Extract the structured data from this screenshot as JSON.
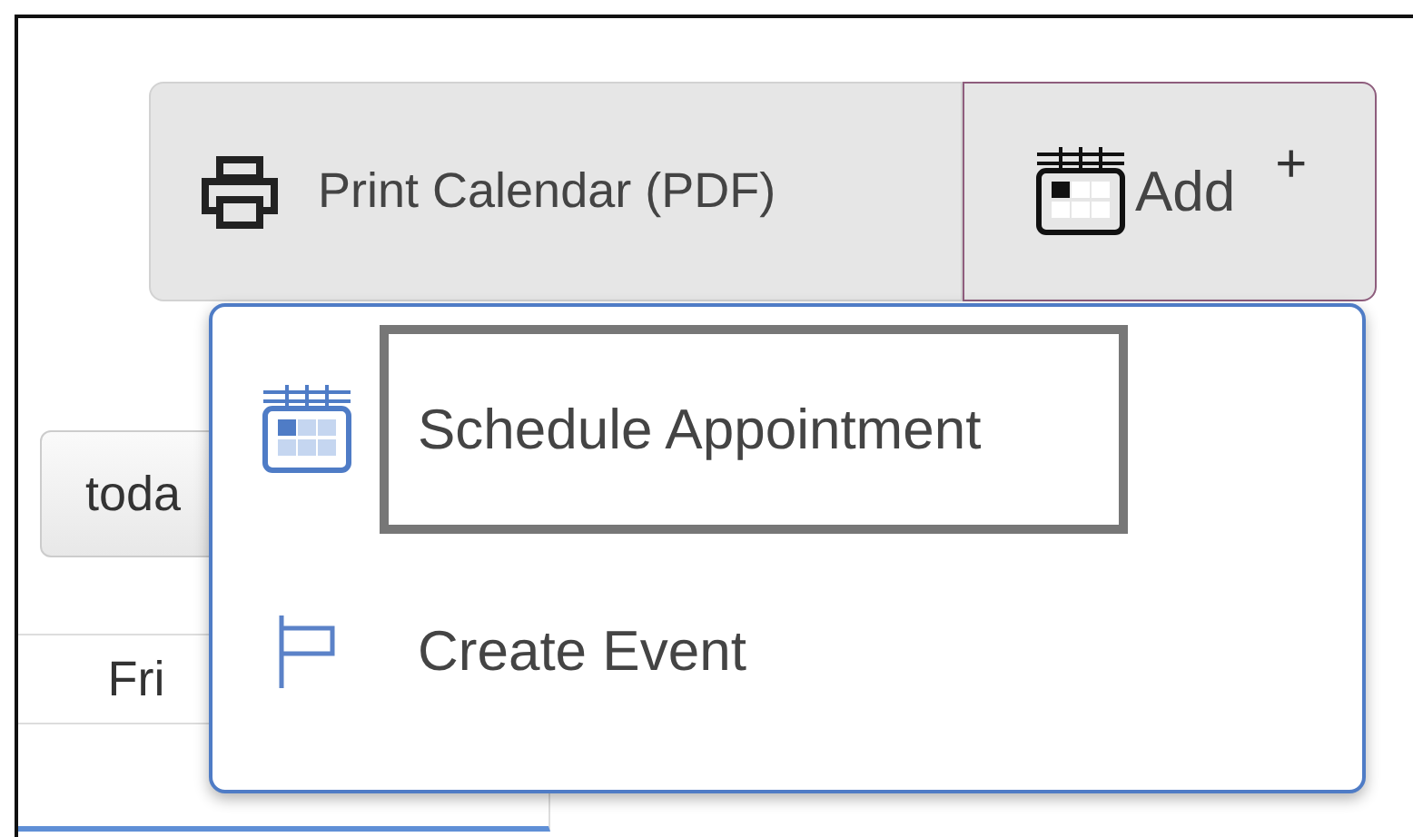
{
  "toolbar": {
    "print_button": {
      "label": "Print Calendar (PDF)"
    },
    "add_button": {
      "label": "Add",
      "plus": "+",
      "focused": true
    }
  },
  "today_button": {
    "label": "toda"
  },
  "day_headers": [
    {
      "label": "Fri"
    }
  ],
  "add_menu": {
    "items": [
      {
        "kind": "appointment",
        "label": "Schedule Appointment",
        "highlighted": true
      },
      {
        "kind": "event",
        "label": "Create Event",
        "highlighted": false
      }
    ]
  }
}
